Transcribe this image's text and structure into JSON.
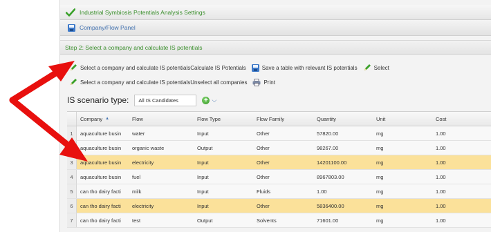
{
  "panel": {
    "title": "Industrial Symbiosis Potentials Analysis Settings",
    "subpanel": "Company/Flow Panel",
    "step": "Step 2: Select a company and calculate IS potentials"
  },
  "toolbar": {
    "row1": [
      {
        "icon": "pencil-icon",
        "label": "Select a company and calculate IS potentialsCalculate IS Potentials"
      },
      {
        "icon": "save-icon",
        "label": "Save a table with relevant IS potentials"
      },
      {
        "icon": "pencil-icon",
        "label": "Select"
      }
    ],
    "row2": [
      {
        "icon": "pencil-icon",
        "label": "Select a company and calculate IS potentialsUnselect all companies"
      },
      {
        "icon": "print-icon",
        "label": "Print"
      }
    ]
  },
  "scenario": {
    "label": "IS scenario type:",
    "value": "All IS Candidates"
  },
  "grid": {
    "columns": [
      "Company",
      "Flow",
      "Flow Type",
      "Flow Family",
      "Quantity",
      "Unit",
      "Cost"
    ],
    "sort_indicator": "▲",
    "rows": [
      {
        "n": "1",
        "company": "aquaculture busin",
        "flow": "water",
        "type": "Input",
        "family": "Other",
        "qty": "57820.00",
        "unit": "mg",
        "cost": "1.00",
        "selected": false
      },
      {
        "n": "2",
        "company": "aquaculture busin",
        "flow": "organic waste",
        "type": "Output",
        "family": "Other",
        "qty": "98267.00",
        "unit": "mg",
        "cost": "1.00",
        "selected": false
      },
      {
        "n": "3",
        "company": "aquaculture busin",
        "flow": "electricity",
        "type": "Input",
        "family": "Other",
        "qty": "14201100.00",
        "unit": "mg",
        "cost": "1.00",
        "selected": true
      },
      {
        "n": "4",
        "company": "aquaculture busin",
        "flow": "fuel",
        "type": "Input",
        "family": "Other",
        "qty": "8967803.00",
        "unit": "mg",
        "cost": "1.00",
        "selected": false
      },
      {
        "n": "5",
        "company": "can tho dairy facti",
        "flow": "milk",
        "type": "Input",
        "family": "Fluids",
        "qty": "1.00",
        "unit": "mg",
        "cost": "1.00",
        "selected": false
      },
      {
        "n": "6",
        "company": "can tho dairy facti",
        "flow": "electricity",
        "type": "Input",
        "family": "Other",
        "qty": "5836400.00",
        "unit": "mg",
        "cost": "1.00",
        "selected": true
      },
      {
        "n": "7",
        "company": "can tho dairy facti",
        "flow": "test",
        "type": "Output",
        "family": "Solvents",
        "qty": "71601.00",
        "unit": "mg",
        "cost": "1.00",
        "selected": false
      }
    ]
  },
  "colors": {
    "accent_green": "#3a8f2c",
    "accent_blue": "#3f6fae",
    "selected_row": "#fbe19a",
    "arrow_red": "#e8100e"
  }
}
